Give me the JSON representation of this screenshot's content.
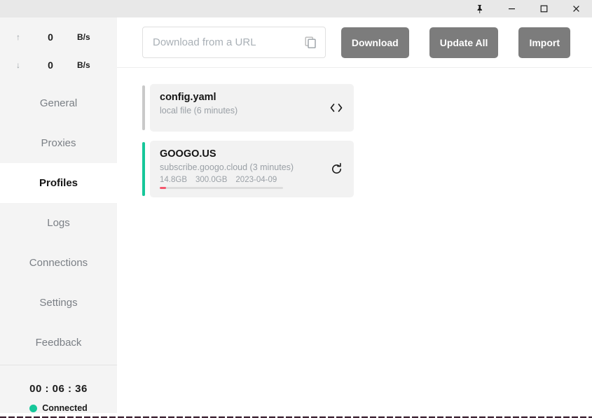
{
  "titlebar": {
    "buttons": [
      {
        "name": "pin-icon",
        "label": "Pin"
      },
      {
        "name": "minimize-icon",
        "label": "Minimize"
      },
      {
        "name": "maximize-icon",
        "label": "Maximize"
      },
      {
        "name": "close-icon",
        "label": "Close"
      }
    ]
  },
  "sidebar": {
    "speed": {
      "upload": {
        "arrow": "↑",
        "value": "0",
        "unit": "B/s"
      },
      "download": {
        "arrow": "↓",
        "value": "0",
        "unit": "B/s"
      }
    },
    "items": [
      {
        "label": "General",
        "active": false
      },
      {
        "label": "Proxies",
        "active": false
      },
      {
        "label": "Profiles",
        "active": true
      },
      {
        "label": "Logs",
        "active": false
      },
      {
        "label": "Connections",
        "active": false
      },
      {
        "label": "Settings",
        "active": false
      },
      {
        "label": "Feedback",
        "active": false
      }
    ],
    "footer": {
      "timer": "00 : 06 : 36",
      "status": "Connected",
      "status_color": "#16c79a"
    }
  },
  "toolbar": {
    "url_placeholder": "Download from a URL",
    "url_value": "",
    "paste_icon": "copy-icon",
    "download_label": "Download",
    "update_all_label": "Update All",
    "import_label": "Import"
  },
  "profiles": [
    {
      "title": "config.yaml",
      "subtitle": "local file (6 minutes)",
      "rail_color": "#c9c9c9",
      "active": false,
      "action_icon": "code-brackets-icon",
      "stats": null,
      "progress_percent": null
    },
    {
      "title": "GOOGO.US",
      "subtitle": "subscribe.googo.cloud (3 minutes)",
      "rail_color": "#16c79a",
      "active": true,
      "action_icon": "refresh-icon",
      "stats": {
        "used": "14.8GB",
        "total": "300.0GB",
        "expiry": "2023-04-09"
      },
      "progress_percent": 5,
      "progress_color": "#f4566d"
    }
  ]
}
